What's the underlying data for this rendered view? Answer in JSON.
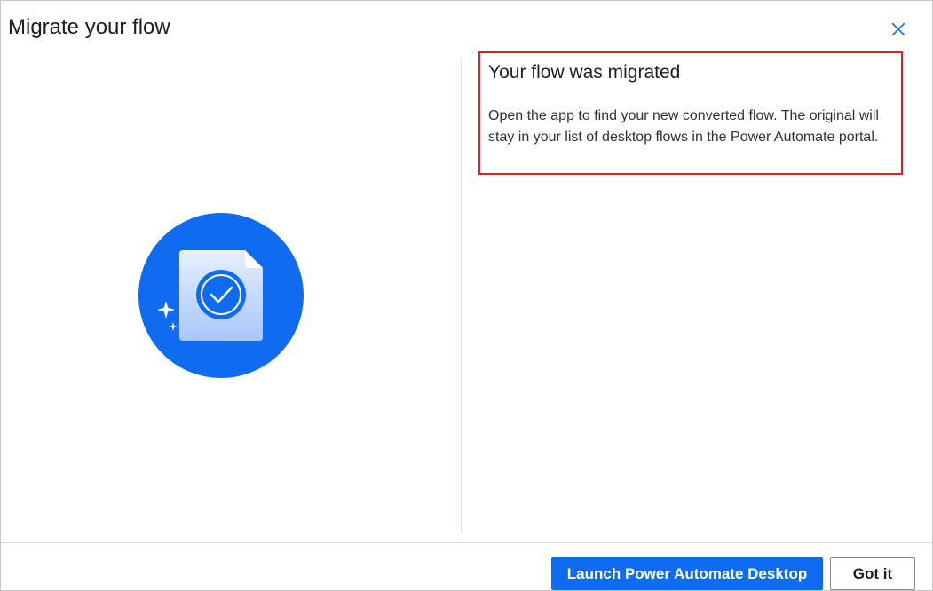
{
  "dialog": {
    "title": "Migrate your flow",
    "close_icon": "close-icon"
  },
  "illustration": {
    "icon": "document-check-icon",
    "sparkle_icon": "sparkle-icon",
    "circle_color": "#0f6cf0"
  },
  "message": {
    "heading": "Your flow was migrated",
    "body": "Open the app to find your new converted flow. The original will stay in your list of desktop flows in the Power Automate portal.",
    "highlight_color": "#d9222a"
  },
  "footer": {
    "primary_label": "Launch Power Automate Desktop",
    "secondary_label": "Got it"
  },
  "colors": {
    "accent": "#0f6cf0"
  }
}
